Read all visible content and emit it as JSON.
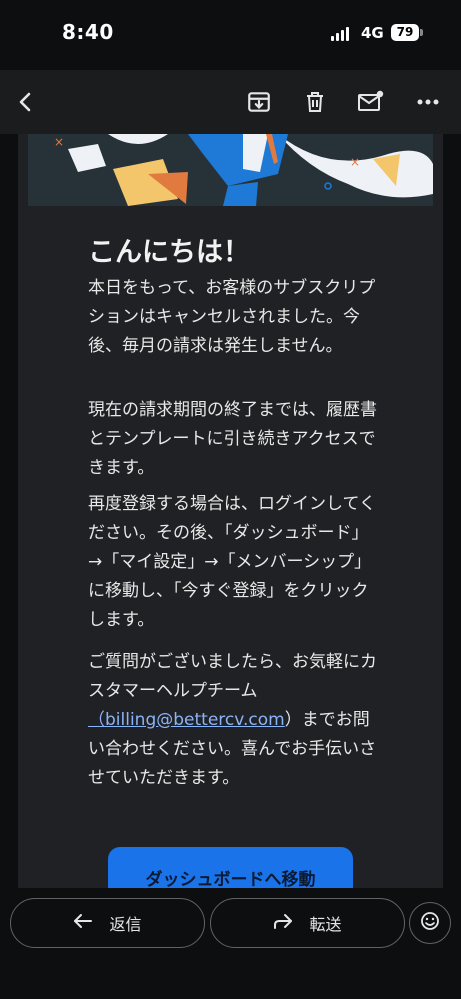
{
  "status_bar": {
    "time": "8:40",
    "network": "4G",
    "battery": "79"
  },
  "toolbar": {
    "icons": [
      "back-arrow-icon",
      "archive-icon",
      "delete-icon",
      "mark-unread-icon",
      "more-icon"
    ]
  },
  "email": {
    "greeting": "こんにちは！",
    "paragraph1": "本日をもって、お客様のサブスクリプションはキャンセルされました。今後、毎月の請求は発生しません。",
    "paragraph2": "現在の請求期間の終了までは、履歴書とテンプレートに引き続きアクセスできます。",
    "paragraph3": "再度登録する場合は、ログインしてください。その後、「ダッシュボード」→「マイ設定」→「メンバーシップ」に移動し、「今すぐ登録」をクリックします。",
    "paragraph4_before": "ご質問がございましたら、お気軽にカスタマーヘルプチーム",
    "paragraph4_link": "（billing@bettercv.com",
    "paragraph4_after": "）までお問い合わせください。喜んでお手伝いさせていただきます。",
    "cta_label": "ダッシュボードへ移動"
  },
  "actions": {
    "reply_label": "返信",
    "forward_label": "転送"
  },
  "colors": {
    "accent": "#1a73e8",
    "link": "#8ab4f8",
    "background": "#202124"
  }
}
